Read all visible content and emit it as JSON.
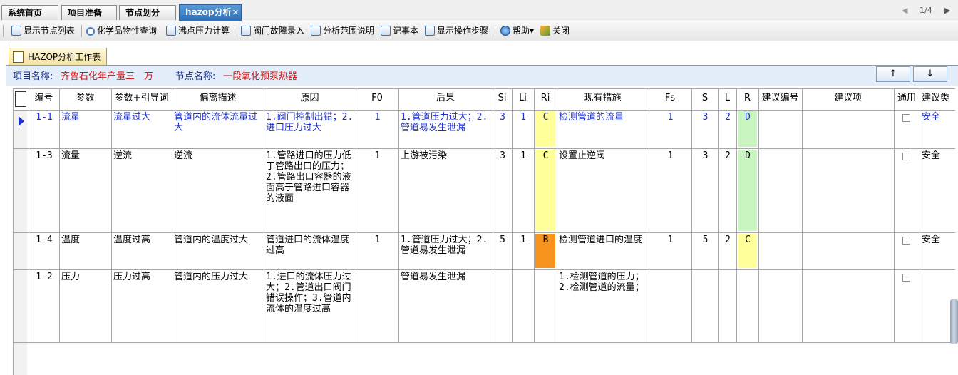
{
  "tabs": [
    {
      "label": "系统首页"
    },
    {
      "label": "项目准备"
    },
    {
      "label": "节点划分"
    },
    {
      "label": "hazop分析",
      "close": "✕"
    }
  ],
  "pager": {
    "prev": "◀",
    "text": "1/4",
    "next": "▶"
  },
  "toolbar": {
    "show_nodes": "显示节点列表",
    "chem_query": "化学品物性查询",
    "boiling": "沸点压力计算",
    "valve": "阀门故障录入",
    "scope": "分析范围说明",
    "notepad": "记事本",
    "steps": "显示操作步骤",
    "help": "帮助",
    "help_arrow": "▾",
    "close": "关闭"
  },
  "worksheet_tab": "HAZOP分析工作表",
  "info": {
    "project_label": "项目名称:",
    "project_value": "齐鲁石化年产量三　万",
    "node_label": "节点名称:",
    "node_value": "一段氧化预泵热器"
  },
  "buttons": {
    "up": "↑",
    "down": "↓"
  },
  "columns": [
    "编号",
    "参数",
    "参数+引导词",
    "偏离描述",
    "原因",
    "F0",
    "后果",
    "Si",
    "Li",
    "Ri",
    "现有措施",
    "Fs",
    "S",
    "L",
    "R",
    "建议编号",
    "建议项",
    "通用",
    "建议类"
  ],
  "rows": [
    {
      "id": "1-1",
      "param": "流量",
      "guide": "流量过大",
      "deviation": "管道内的流体流量过大",
      "cause": "1.阀门控制出错；2.进口压力过大",
      "f0": "1",
      "consequence": "1.管道压力过大；2.管道易发生泄漏",
      "si": "3",
      "li": "1",
      "ri": "C",
      "measure": "检测管道的流量",
      "fs": "1",
      "s": "3",
      "l": "2",
      "r": "D",
      "sug_no": "",
      "sug": "",
      "common": false,
      "sug_type": "安全",
      "selected": true
    },
    {
      "id": "1-3",
      "param": "流量",
      "guide": "逆流",
      "deviation": "逆流",
      "cause": "1.管路进口的压力低于管路出口的压力；2.管路出口容器的液面高于管路进口容器的液面",
      "f0": "1",
      "consequence": "上游被污染",
      "si": "3",
      "li": "1",
      "ri": "C",
      "measure": "设置止逆阀",
      "fs": "1",
      "s": "3",
      "l": "2",
      "r": "D",
      "sug_no": "",
      "sug": "",
      "common": false,
      "sug_type": "安全",
      "selected": false
    },
    {
      "id": "1-4",
      "param": "温度",
      "guide": "温度过高",
      "deviation": "管道内的温度过大",
      "cause": "管道进口的流体温度过高",
      "f0": "1",
      "consequence": "1.管道压力过大；2.管道易发生泄漏",
      "si": "5",
      "li": "1",
      "ri": "B",
      "measure": "检测管道进口的温度",
      "fs": "1",
      "s": "5",
      "l": "2",
      "r": "C",
      "sug_no": "",
      "sug": "",
      "common": false,
      "sug_type": "安全",
      "selected": false
    },
    {
      "id": "1-2",
      "param": "压力",
      "guide": "压力过高",
      "deviation": "管道内的压力过大",
      "cause": "1.进口的流体压力过大；2.管道出口阀门错误操作；3.管道内流体的温度过高",
      "f0": "",
      "consequence": "管道易发生泄漏",
      "si": "",
      "li": "",
      "ri": "",
      "measure": "1.检测管道的压力；2.检测管道的流量；",
      "fs": "",
      "s": "",
      "l": "",
      "r": "",
      "sug_no": "",
      "sug": "",
      "common": false,
      "sug_type": "",
      "selected": false
    }
  ],
  "risk_colors": {
    "B": "#f7941d",
    "C": "#ffff99",
    "D": "#c8f5c0"
  },
  "row_indicator_icon": "triangle-right-icon"
}
